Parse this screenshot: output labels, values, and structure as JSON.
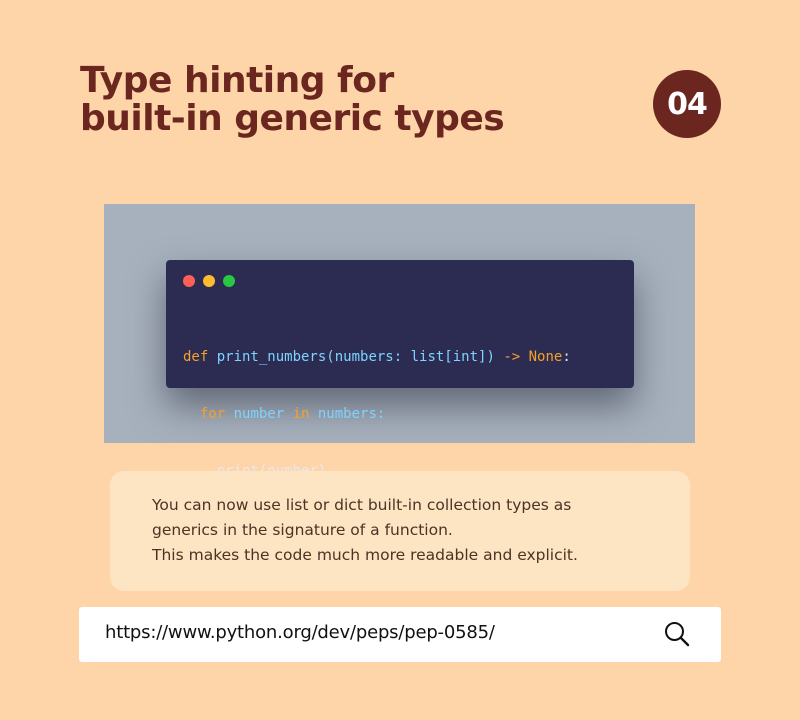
{
  "header": {
    "title_line1": "Type hinting for",
    "title_line2": "built-in generic types",
    "badge": "04"
  },
  "code_window": {
    "dots": [
      "red",
      "yellow",
      "green"
    ],
    "line1": {
      "kw_def": "def ",
      "fn_name": "print_numbers",
      "params": "(numbers: list[int]) ",
      "arrow": "->",
      "space": " ",
      "none": "None",
      "colon": ":"
    },
    "line2": {
      "indent": "  ",
      "kw_for": "for",
      "var": " number ",
      "kw_in": "in",
      "rest": " numbers:"
    },
    "line3": {
      "indent": "    ",
      "call": "print(number)"
    }
  },
  "description": {
    "line1": "You can now use list or dict built-in collection types as",
    "line2": "generics in the signature of a function.",
    "line3": "This makes the code much more readable and explicit."
  },
  "url_bar": {
    "url": "https://www.python.org/dev/peps/pep-0585/",
    "icon": "search-icon"
  },
  "colors": {
    "background": "#fdd5a8",
    "title": "#6b2620",
    "badge_bg": "#6b2620",
    "code_bg": "#2c2b52",
    "code_keyword": "#f4a12c",
    "code_function": "#7fd3ff",
    "frame_bg": "#a7b1bd",
    "desc_bg": "#fde4c3"
  }
}
